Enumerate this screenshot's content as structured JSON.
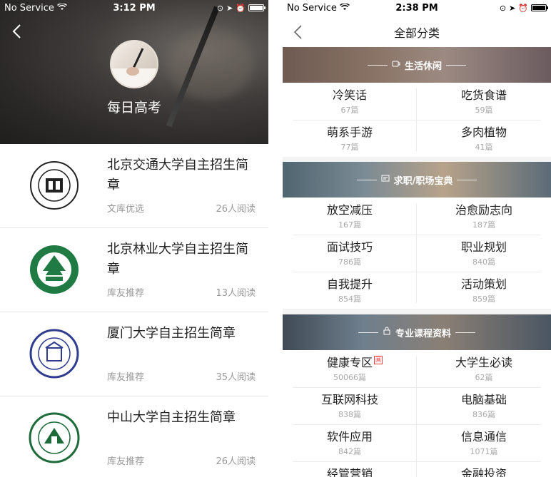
{
  "left": {
    "status": {
      "carrier": "No Service",
      "time": "3:12 PM"
    },
    "header": {
      "title": "每日高考"
    },
    "items": [
      {
        "title": "北京交通大学自主招生简章",
        "source": "文库优选",
        "reads": "26人阅读"
      },
      {
        "title": "北京林业大学自主招生简章",
        "source": "库友推荐",
        "reads": "13人阅读"
      },
      {
        "title": "厦门大学自主招生简章",
        "source": "库友推荐",
        "reads": "35人阅读"
      },
      {
        "title": "中山大学自主招生简章",
        "source": "库友推荐",
        "reads": "26人阅读"
      }
    ]
  },
  "right": {
    "status": {
      "carrier": "No Service",
      "time": "2:38 PM"
    },
    "nav": {
      "title": "全部分类"
    },
    "sections": [
      {
        "title": "生活休闲",
        "items": [
          {
            "name": "冷笑话",
            "count": "67篇"
          },
          {
            "name": "吃货食谱",
            "count": "59篇"
          },
          {
            "name": "萌系手游",
            "count": "77篇"
          },
          {
            "name": "多肉植物",
            "count": "41篇"
          }
        ]
      },
      {
        "title": "求职/职场宝典",
        "items": [
          {
            "name": "放空减压",
            "count": "167篇"
          },
          {
            "name": "治愈励志向",
            "count": "187篇"
          },
          {
            "name": "面试技巧",
            "count": "786篇"
          },
          {
            "name": "职业规划",
            "count": "840篇"
          },
          {
            "name": "自我提升",
            "count": "854篇"
          },
          {
            "name": "活动策划",
            "count": "859篇"
          }
        ]
      },
      {
        "title": "专业课程资料",
        "items": [
          {
            "name": "健康专区",
            "count": "50066篇",
            "badge": "画"
          },
          {
            "name": "大学生必读",
            "count": "62篇"
          },
          {
            "name": "互联网科技",
            "count": "838篇"
          },
          {
            "name": "电脑基础",
            "count": "836篇"
          },
          {
            "name": "软件应用",
            "count": "842篇"
          },
          {
            "name": "信息通信",
            "count": "1071篇"
          },
          {
            "name": "经管营销",
            "count": ""
          },
          {
            "name": "金融投资",
            "count": ""
          }
        ]
      }
    ]
  },
  "colors": {
    "hero_dark": "#2a2827",
    "accent_badge": "#ff4444",
    "divider": "#ececec"
  }
}
